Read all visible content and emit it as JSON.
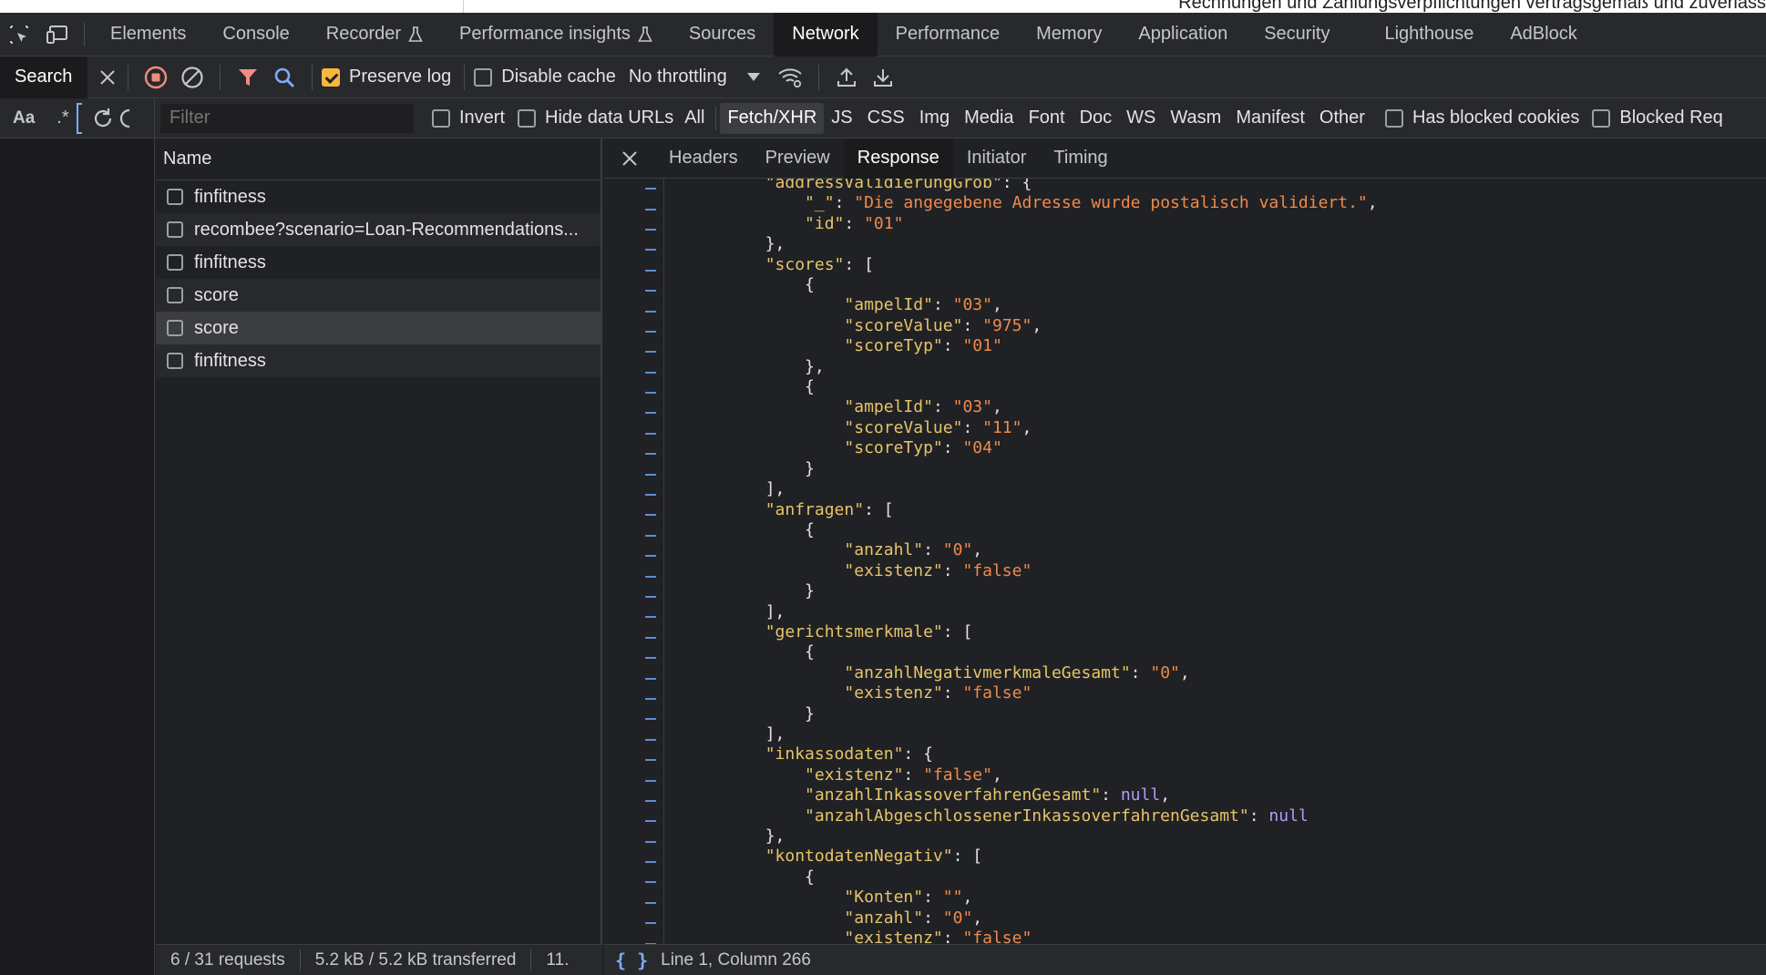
{
  "page_strip": {
    "text": "Rechnungen und Zahlungsverpflichtungen vertragsgemäß und zuverläss"
  },
  "tabs": [
    {
      "label": "Elements"
    },
    {
      "label": "Console"
    },
    {
      "label": "Recorder"
    },
    {
      "label": "Performance insights"
    },
    {
      "label": "Sources"
    },
    {
      "label": "Network"
    },
    {
      "label": "Performance"
    },
    {
      "label": "Memory"
    },
    {
      "label": "Application"
    },
    {
      "label": "Security"
    },
    {
      "label": "Lighthouse"
    },
    {
      "label": "AdBlock"
    }
  ],
  "toolbar": {
    "search_label": "Search",
    "preserve_log": "Preserve log",
    "disable_cache": "Disable cache",
    "throttling": "No throttling"
  },
  "filterbar": {
    "case_label": "Aa",
    "regex_label": ".*",
    "filter_placeholder": "Filter",
    "invert": "Invert",
    "hide_data_urls": "Hide data URLs",
    "types": [
      "All",
      "Fetch/XHR",
      "JS",
      "CSS",
      "Img",
      "Media",
      "Font",
      "Doc",
      "WS",
      "Wasm",
      "Manifest",
      "Other"
    ],
    "has_blocked_cookies": "Has blocked cookies",
    "blocked_requests": "Blocked Req"
  },
  "requests": {
    "header": "Name",
    "rows": [
      {
        "name": "finfitness"
      },
      {
        "name": "recombee?scenario=Loan-Recommendations..."
      },
      {
        "name": "finfitness"
      },
      {
        "name": "score"
      },
      {
        "name": "score"
      },
      {
        "name": "finfitness"
      }
    ]
  },
  "response": {
    "tabs": [
      "Headers",
      "Preview",
      "Response",
      "Initiator",
      "Timing"
    ],
    "lines": [
      [
        [
          "        ",
          "p"
        ],
        [
          "\"addressValidierungGrob\"",
          "k"
        ],
        [
          ": {",
          "p"
        ]
      ],
      [
        [
          "            ",
          "p"
        ],
        [
          "\"_\"",
          "k"
        ],
        [
          ": ",
          "p"
        ],
        [
          "\"Die angegebene Adresse wurde postalisch validiert.\"",
          "s"
        ],
        [
          ",",
          "p"
        ]
      ],
      [
        [
          "            ",
          "p"
        ],
        [
          "\"id\"",
          "k"
        ],
        [
          ": ",
          "p"
        ],
        [
          "\"01\"",
          "s"
        ]
      ],
      [
        [
          "        },",
          "p"
        ]
      ],
      [
        [
          "        ",
          "p"
        ],
        [
          "\"scores\"",
          "k"
        ],
        [
          ": [",
          "p"
        ]
      ],
      [
        [
          "            {",
          "p"
        ]
      ],
      [
        [
          "                ",
          "p"
        ],
        [
          "\"ampelId\"",
          "k"
        ],
        [
          ": ",
          "p"
        ],
        [
          "\"03\"",
          "s"
        ],
        [
          ",",
          "p"
        ]
      ],
      [
        [
          "                ",
          "p"
        ],
        [
          "\"scoreValue\"",
          "k"
        ],
        [
          ": ",
          "p"
        ],
        [
          "\"975\"",
          "s"
        ],
        [
          ",",
          "p"
        ]
      ],
      [
        [
          "                ",
          "p"
        ],
        [
          "\"scoreTyp\"",
          "k"
        ],
        [
          ": ",
          "p"
        ],
        [
          "\"01\"",
          "s"
        ]
      ],
      [
        [
          "            },",
          "p"
        ]
      ],
      [
        [
          "            {",
          "p"
        ]
      ],
      [
        [
          "                ",
          "p"
        ],
        [
          "\"ampelId\"",
          "k"
        ],
        [
          ": ",
          "p"
        ],
        [
          "\"03\"",
          "s"
        ],
        [
          ",",
          "p"
        ]
      ],
      [
        [
          "                ",
          "p"
        ],
        [
          "\"scoreValue\"",
          "k"
        ],
        [
          ": ",
          "p"
        ],
        [
          "\"11\"",
          "s"
        ],
        [
          ",",
          "p"
        ]
      ],
      [
        [
          "                ",
          "p"
        ],
        [
          "\"scoreTyp\"",
          "k"
        ],
        [
          ": ",
          "p"
        ],
        [
          "\"04\"",
          "s"
        ]
      ],
      [
        [
          "            }",
          "p"
        ]
      ],
      [
        [
          "        ],",
          "p"
        ]
      ],
      [
        [
          "        ",
          "p"
        ],
        [
          "\"anfragen\"",
          "k"
        ],
        [
          ": [",
          "p"
        ]
      ],
      [
        [
          "            {",
          "p"
        ]
      ],
      [
        [
          "                ",
          "p"
        ],
        [
          "\"anzahl\"",
          "k"
        ],
        [
          ": ",
          "p"
        ],
        [
          "\"0\"",
          "s"
        ],
        [
          ",",
          "p"
        ]
      ],
      [
        [
          "                ",
          "p"
        ],
        [
          "\"existenz\"",
          "k"
        ],
        [
          ": ",
          "p"
        ],
        [
          "\"false\"",
          "s"
        ]
      ],
      [
        [
          "            }",
          "p"
        ]
      ],
      [
        [
          "        ],",
          "p"
        ]
      ],
      [
        [
          "        ",
          "p"
        ],
        [
          "\"gerichtsmerkmale\"",
          "k"
        ],
        [
          ": [",
          "p"
        ]
      ],
      [
        [
          "            {",
          "p"
        ]
      ],
      [
        [
          "                ",
          "p"
        ],
        [
          "\"anzahlNegativmerkmaleGesamt\"",
          "k"
        ],
        [
          ": ",
          "p"
        ],
        [
          "\"0\"",
          "s"
        ],
        [
          ",",
          "p"
        ]
      ],
      [
        [
          "                ",
          "p"
        ],
        [
          "\"existenz\"",
          "k"
        ],
        [
          ": ",
          "p"
        ],
        [
          "\"false\"",
          "s"
        ]
      ],
      [
        [
          "            }",
          "p"
        ]
      ],
      [
        [
          "        ],",
          "p"
        ]
      ],
      [
        [
          "        ",
          "p"
        ],
        [
          "\"inkassodaten\"",
          "k"
        ],
        [
          ": {",
          "p"
        ]
      ],
      [
        [
          "            ",
          "p"
        ],
        [
          "\"existenz\"",
          "k"
        ],
        [
          ": ",
          "p"
        ],
        [
          "\"false\"",
          "s"
        ],
        [
          ",",
          "p"
        ]
      ],
      [
        [
          "            ",
          "p"
        ],
        [
          "\"anzahlInkassoverfahrenGesamt\"",
          "k"
        ],
        [
          ": ",
          "p"
        ],
        [
          "null",
          "n"
        ],
        [
          ",",
          "p"
        ]
      ],
      [
        [
          "            ",
          "p"
        ],
        [
          "\"anzahlAbgeschlossenerInkassoverfahrenGesamt\"",
          "k"
        ],
        [
          ": ",
          "p"
        ],
        [
          "null",
          "n"
        ]
      ],
      [
        [
          "        },",
          "p"
        ]
      ],
      [
        [
          "        ",
          "p"
        ],
        [
          "\"kontodatenNegativ\"",
          "k"
        ],
        [
          ": [",
          "p"
        ]
      ],
      [
        [
          "            {",
          "p"
        ]
      ],
      [
        [
          "                ",
          "p"
        ],
        [
          "\"Konten\"",
          "k"
        ],
        [
          ": ",
          "p"
        ],
        [
          "\"\"",
          "s"
        ],
        [
          ",",
          "p"
        ]
      ],
      [
        [
          "                ",
          "p"
        ],
        [
          "\"anzahl\"",
          "k"
        ],
        [
          ": ",
          "p"
        ],
        [
          "\"0\"",
          "s"
        ],
        [
          ",",
          "p"
        ]
      ],
      [
        [
          "                ",
          "p"
        ],
        [
          "\"existenz\"",
          "k"
        ],
        [
          ": ",
          "p"
        ],
        [
          "\"false\"",
          "s"
        ]
      ]
    ],
    "cursor_position": "Line 1, Column 266",
    "format_icon": "{ }"
  },
  "status": {
    "requests": "6 / 31 requests",
    "transferred": "5.2 kB / 5.2 kB transferred",
    "extra": "11."
  },
  "colors": {
    "accent_blue": "#7cacf8",
    "record_red": "#f28b82",
    "filter_red": "#f28b82",
    "checkbox_orange": "#f6b73c"
  }
}
